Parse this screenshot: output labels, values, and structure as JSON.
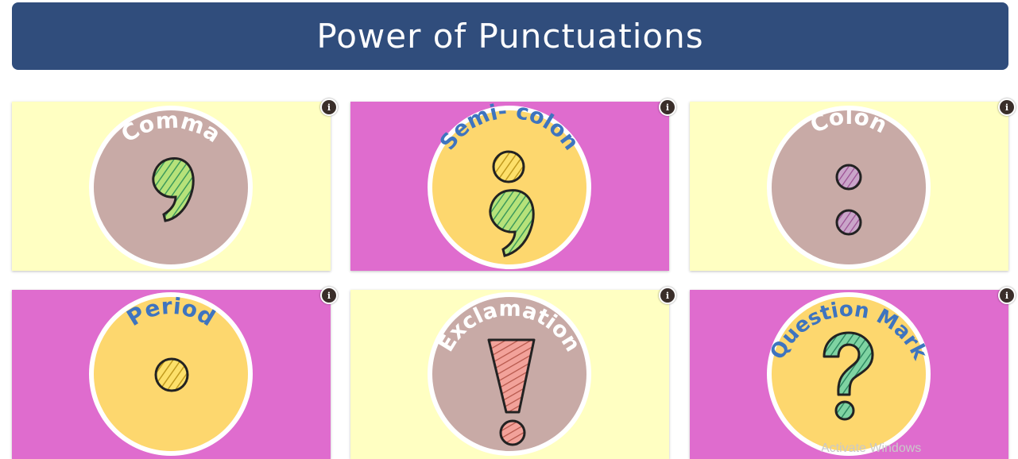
{
  "header": {
    "title": "Power of Punctuations"
  },
  "cards": [
    {
      "label": "Comma",
      "bg": "#ffffc2",
      "circle": "#c8aaa6",
      "text_color": "#ffffff",
      "info": "i"
    },
    {
      "label": "Semi- colon",
      "bg": "#df6cce",
      "circle": "#fdd76e",
      "text_color": "#3e74bf",
      "info": "i"
    },
    {
      "label": "Colon",
      "bg": "#ffffc2",
      "circle": "#c8aaa6",
      "text_color": "#ffffff",
      "info": "i"
    },
    {
      "label": "Period",
      "bg": "#df6cce",
      "circle": "#fdd76e",
      "text_color": "#3e74bf",
      "info": "i"
    },
    {
      "label": "Exclamation",
      "bg": "#ffffc2",
      "circle": "#c8aaa6",
      "text_color": "#ffffff",
      "info": "i"
    },
    {
      "label": "Question Mark",
      "bg": "#df6cce",
      "circle": "#fdd76e",
      "text_color": "#3e74bf",
      "info": "i"
    }
  ],
  "watermark": "Activate Windows"
}
